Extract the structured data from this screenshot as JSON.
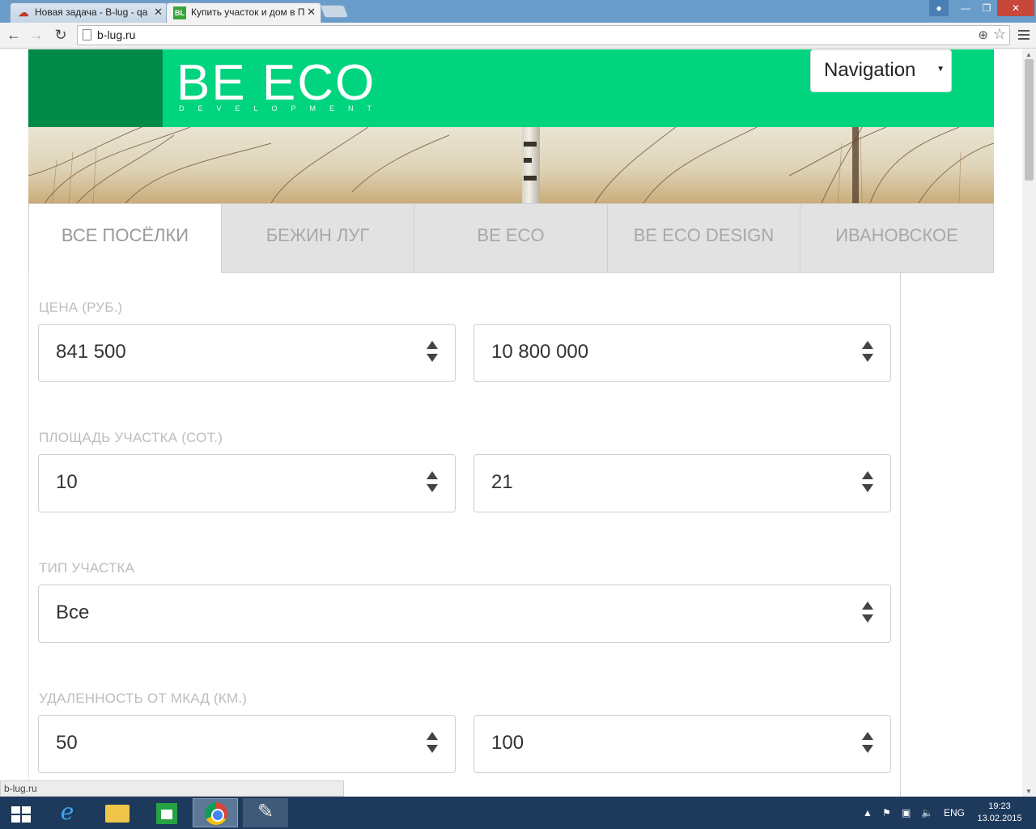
{
  "browser": {
    "tabs": [
      {
        "title": "Новая задача - B-lug - qa",
        "favicon": "cloud-icon",
        "active": false
      },
      {
        "title": "Купить участок и дом в П",
        "favicon_text": "BL",
        "active": true
      }
    ],
    "url": "b-lug.ru",
    "status_url": "b-lug.ru"
  },
  "site": {
    "logo_text": "BE ECO",
    "logo_sub": "DEVELOPMENT",
    "navigation_select": "Navigation",
    "brand_colors": {
      "header": "#00d47e",
      "logo_block": "#008a4a"
    }
  },
  "village_tabs": [
    {
      "label": "ВСЕ ПОСЁЛКИ",
      "active": true
    },
    {
      "label": "БЕЖИН ЛУГ",
      "active": false
    },
    {
      "label": "BE ECO",
      "active": false
    },
    {
      "label": "BE ECO DESIGN",
      "active": false
    },
    {
      "label": "ИВАНОВСКОЕ",
      "active": false
    }
  ],
  "filters": {
    "price": {
      "label": "ЦЕНА (РУБ.)",
      "min": "841 500",
      "max": "10 800 000"
    },
    "area": {
      "label": "ПЛОЩАДЬ УЧАСТКА (СОТ.)",
      "min": "10",
      "max": "21"
    },
    "type": {
      "label": "ТИП УЧАСТКА",
      "value": "Все"
    },
    "distance": {
      "label": "УДАЛЕННОСТЬ ОТ МКАД (КМ.)",
      "min": "50",
      "max": "100"
    }
  },
  "taskbar": {
    "language": "ENG",
    "time": "19:23",
    "date": "13.02.2015"
  }
}
